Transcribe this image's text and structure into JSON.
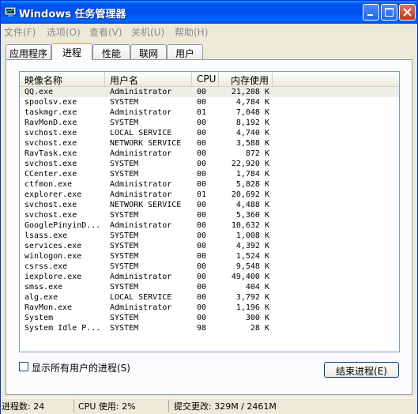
{
  "window": {
    "title": "Windows 任务管理器"
  },
  "menu": [
    {
      "label": "文件(F)"
    },
    {
      "label": "选项(O)"
    },
    {
      "label": "查看(V)"
    },
    {
      "label": "关机(U)"
    },
    {
      "label": "帮助(H)"
    }
  ],
  "tabs": [
    {
      "label": "应用程序"
    },
    {
      "label": "进程"
    },
    {
      "label": "性能"
    },
    {
      "label": "联网"
    },
    {
      "label": "用户"
    }
  ],
  "columns": {
    "name": "映像名称",
    "user": "用户名",
    "cpu": "CPU",
    "mem": "内存使用"
  },
  "processes": [
    {
      "name": "QQ.exe",
      "user": "Administrator",
      "cpu": "00",
      "mem": "21,208 K"
    },
    {
      "name": "spoolsv.exe",
      "user": "SYSTEM",
      "cpu": "00",
      "mem": "4,784 K"
    },
    {
      "name": "taskmgr.exe",
      "user": "Administrator",
      "cpu": "01",
      "mem": "7,048 K"
    },
    {
      "name": "RavMonD.exe",
      "user": "SYSTEM",
      "cpu": "00",
      "mem": "8,192 K"
    },
    {
      "name": "svchost.exe",
      "user": "LOCAL SERVICE",
      "cpu": "00",
      "mem": "4,740 K"
    },
    {
      "name": "svchost.exe",
      "user": "NETWORK SERVICE",
      "cpu": "00",
      "mem": "3,588 K"
    },
    {
      "name": "RavTask.exe",
      "user": "Administrator",
      "cpu": "00",
      "mem": "872 K"
    },
    {
      "name": "svchost.exe",
      "user": "SYSTEM",
      "cpu": "00",
      "mem": "22,920 K"
    },
    {
      "name": "CCenter.exe",
      "user": "SYSTEM",
      "cpu": "00",
      "mem": "1,784 K"
    },
    {
      "name": "ctfmon.exe",
      "user": "Administrator",
      "cpu": "00",
      "mem": "5,828 K"
    },
    {
      "name": "explorer.exe",
      "user": "Administrator",
      "cpu": "01",
      "mem": "20,692 K"
    },
    {
      "name": "svchost.exe",
      "user": "NETWORK SERVICE",
      "cpu": "00",
      "mem": "4,488 K"
    },
    {
      "name": "svchost.exe",
      "user": "SYSTEM",
      "cpu": "00",
      "mem": "5,360 K"
    },
    {
      "name": "GooglePinyinD...",
      "user": "Administrator",
      "cpu": "00",
      "mem": "10,632 K"
    },
    {
      "name": "lsass.exe",
      "user": "SYSTEM",
      "cpu": "00",
      "mem": "1,008 K"
    },
    {
      "name": "services.exe",
      "user": "SYSTEM",
      "cpu": "00",
      "mem": "4,392 K"
    },
    {
      "name": "winlogon.exe",
      "user": "SYSTEM",
      "cpu": "00",
      "mem": "1,524 K"
    },
    {
      "name": "csrss.exe",
      "user": "SYSTEM",
      "cpu": "00",
      "mem": "9,548 K"
    },
    {
      "name": "iexplore.exe",
      "user": "Administrator",
      "cpu": "00",
      "mem": "49,400 K"
    },
    {
      "name": "smss.exe",
      "user": "SYSTEM",
      "cpu": "00",
      "mem": "404 K"
    },
    {
      "name": "alg.exe",
      "user": "LOCAL SERVICE",
      "cpu": "00",
      "mem": "3,792 K"
    },
    {
      "name": "RavMon.exe",
      "user": "Administrator",
      "cpu": "00",
      "mem": "1,196 K"
    },
    {
      "name": "System",
      "user": "SYSTEM",
      "cpu": "00",
      "mem": "300 K"
    },
    {
      "name": "System Idle P...",
      "user": "SYSTEM",
      "cpu": "98",
      "mem": "28 K"
    }
  ],
  "show_all_users": {
    "label": "显示所有用户的进程(S)",
    "checked": false
  },
  "end_process_button": "结束进程(E)",
  "status": {
    "processes": "进程数: 24",
    "cpu": "CPU 使用: 2%",
    "commit": "提交更改: 329M / 2461M"
  },
  "colors": {
    "title_bar": "#0053ee",
    "tab_highlight": "#ffc83c"
  }
}
